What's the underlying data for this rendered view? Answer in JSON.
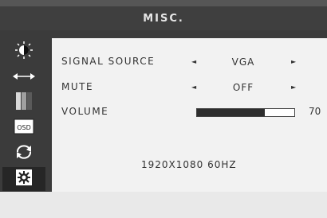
{
  "osd": {
    "title": "MISC.",
    "sidebar": [
      {
        "icon": "brightness-icon"
      },
      {
        "icon": "position-arrows-icon"
      },
      {
        "icon": "color-bars-icon"
      },
      {
        "icon": "osd-icon",
        "label": "OSD"
      },
      {
        "icon": "reset-cycle-icon"
      },
      {
        "icon": "gear-icon",
        "selected": true
      }
    ],
    "rows": {
      "signal_source": {
        "label": "SIGNAL SOURCE",
        "value": "VGA",
        "left_arrow": "◄",
        "right_arrow": "►"
      },
      "mute": {
        "label": "MUTE",
        "value": "OFF",
        "left_arrow": "◄",
        "right_arrow": "►"
      },
      "volume": {
        "label": "VOLUME",
        "value": "70",
        "level_percent": 70
      }
    },
    "status": {
      "resolution": "1920X1080 60HZ"
    }
  }
}
